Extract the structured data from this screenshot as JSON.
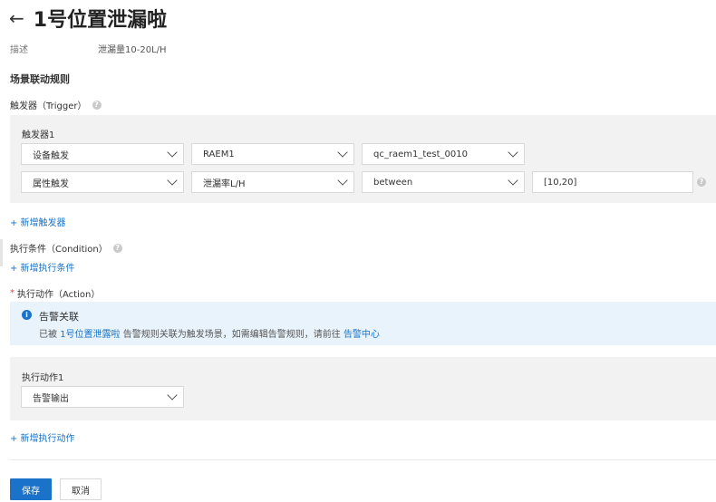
{
  "header": {
    "back_icon": "←",
    "title": "1号位置泄漏啦"
  },
  "description": {
    "label": "描述",
    "value": "泄漏量10-20L/H"
  },
  "rules": {
    "section_title": "场景联动规则",
    "trigger": {
      "label": "触发器（Trigger）",
      "group_title": "触发器1",
      "row1": {
        "type": "设备触发",
        "device": "RAEM1",
        "product": "qc_raem1_test_0010"
      },
      "row2": {
        "type": "属性触发",
        "property": "泄漏率L/H",
        "operator": "between",
        "value": "[10,20]"
      },
      "add_link": "+ 新增触发器"
    },
    "condition": {
      "label": "执行条件（Condition）",
      "add_link": "+ 新增执行条件"
    },
    "action": {
      "required_mark": "*",
      "label": "执行动作（Action）",
      "notice": {
        "title": "告警关联",
        "text_prefix": "已被",
        "link1": "1号位置泄露啦",
        "text_middle": "告警规则关联为触发场景，如需编辑告警规则，请前往",
        "link2": "告警中心"
      },
      "group_title": "执行动作1",
      "select": "告警输出",
      "add_link": "+ 新增执行动作"
    }
  },
  "footer": {
    "save": "保存",
    "cancel": "取消"
  },
  "colors": {
    "primary": "#1a73c8",
    "panel": "#f2f2f2",
    "notice_bg": "#e8f3fc",
    "required": "#e54545"
  }
}
